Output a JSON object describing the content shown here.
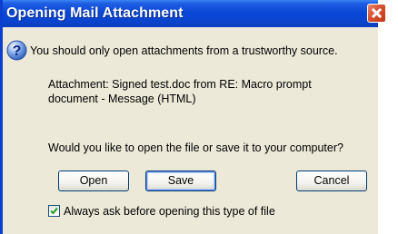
{
  "window": {
    "title": "Opening Mail Attachment"
  },
  "message": {
    "warning": "You should only open attachments from a trustworthy source.",
    "attachment_line1": "Attachment: Signed test.doc from RE: Macro prompt",
    "attachment_line2": "document - Message (HTML)",
    "question": "Would you like to open the file or save it to your computer?"
  },
  "buttons": {
    "open_label": "Open",
    "save_label": "Save",
    "cancel_label": "Cancel"
  },
  "checkbox": {
    "label": "Always ask before opening this type of file",
    "checked": true
  },
  "icons": {
    "title_close": "close-icon",
    "question": "question-icon"
  },
  "colors": {
    "titlebar": "#0b47d6",
    "dialog_bg": "#ece9d8",
    "close": "#d6502e",
    "button_border": "#003c74",
    "checkmark": "#21a121"
  }
}
